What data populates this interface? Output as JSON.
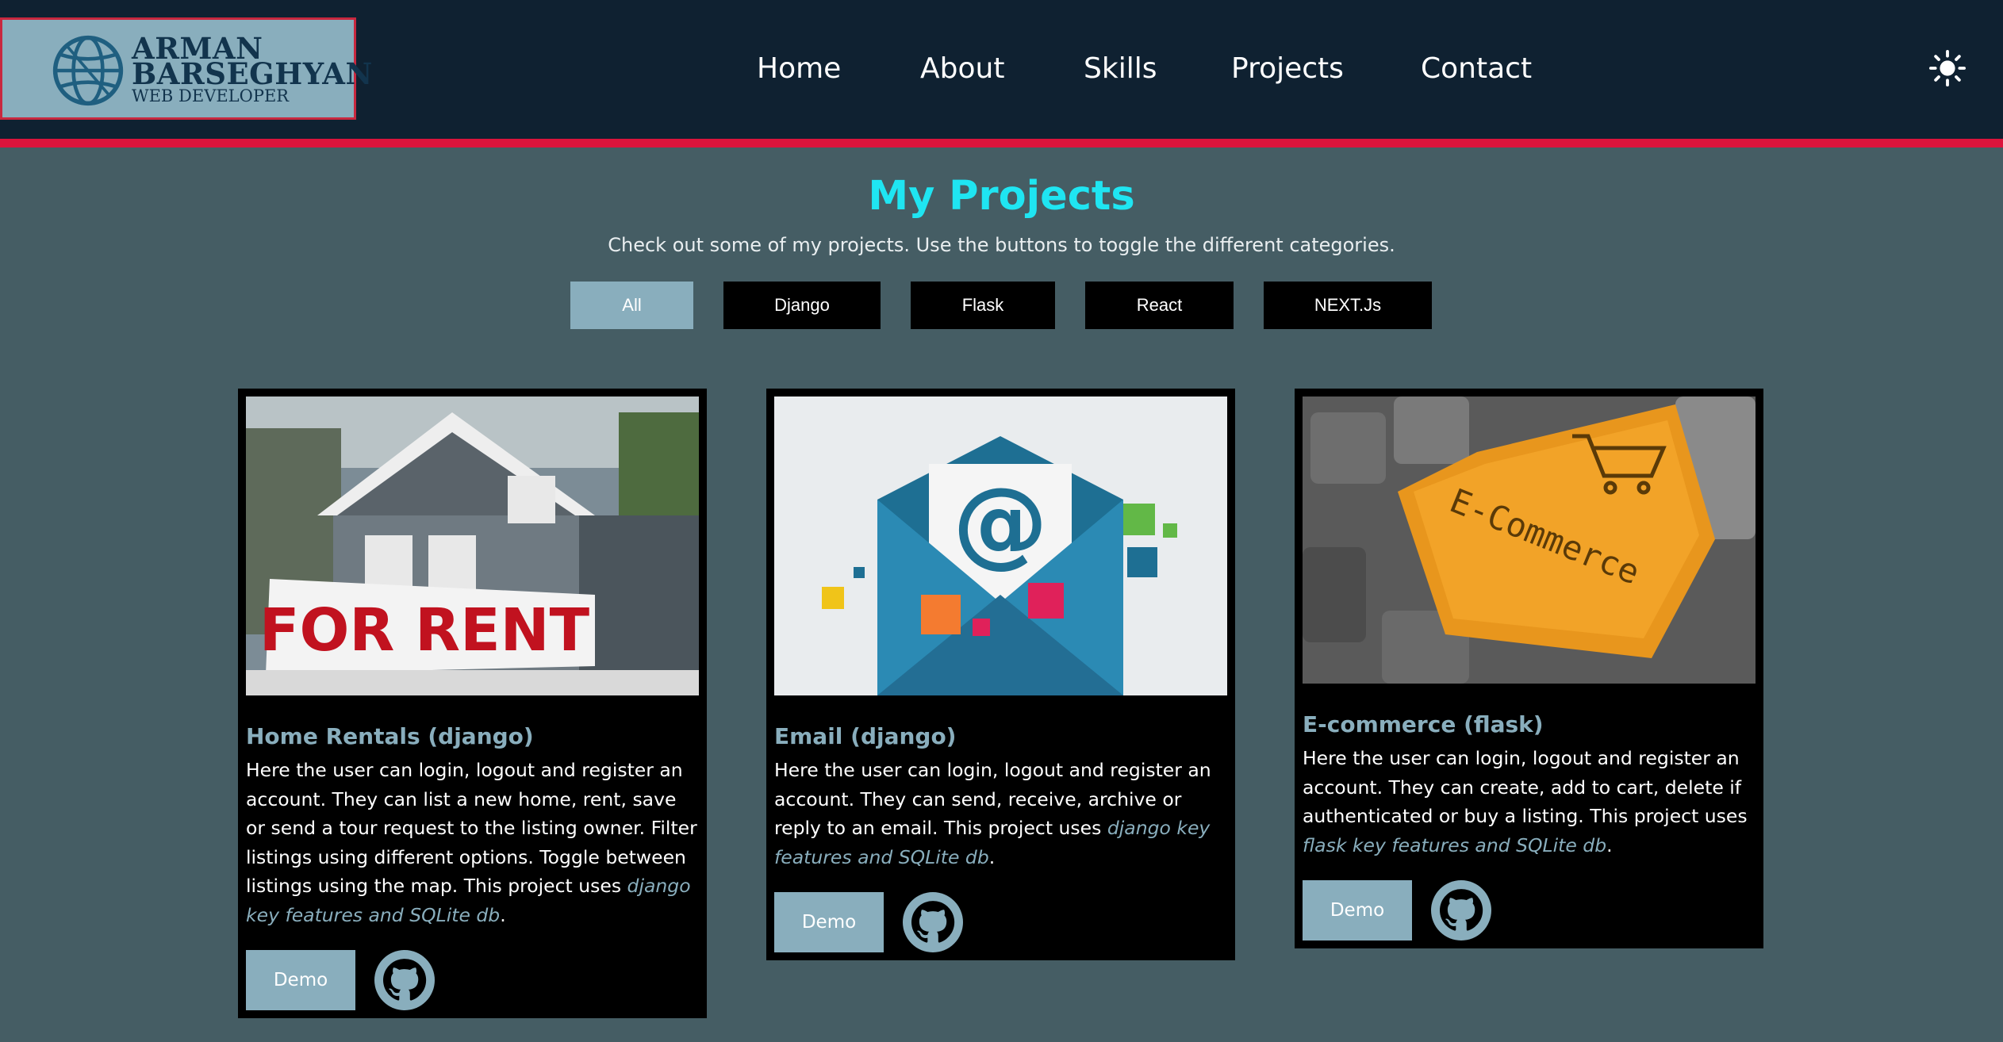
{
  "header": {
    "logo": {
      "name_line1": "ARMAN",
      "name_line2": "BARSEGHYAN",
      "role": "WEB DEVELOPER",
      "icon": "globe-icon"
    },
    "nav": [
      "Home",
      "About",
      "Skills",
      "Projects",
      "Contact"
    ],
    "theme_icon": "sun-icon"
  },
  "projects": {
    "title": "My Projects",
    "subtitle": "Check out some of my projects. Use the buttons to toggle the different categories.",
    "filters": [
      "All",
      "Django",
      "Flask",
      "React",
      "NEXT.Js"
    ],
    "active_filter": "All",
    "cards": [
      {
        "title": "Home Rentals (django)",
        "desc": "Here the user can login, logout and register an account. They can list a new home, rent, save or send a tour request to the listing owner. Filter listings using different options. Toggle between listings using the map. This project uses ",
        "desc_em": "django key features and SQLite db",
        "desc_end": ".",
        "image_text": "FOR RENT",
        "demo_label": "Demo",
        "icon": "github-icon"
      },
      {
        "title": "Email (django)",
        "desc": "Here the user can login, logout and register an account. They can send, receive, archive or reply to an email. This project uses ",
        "desc_em": "django key features and SQLite db",
        "desc_end": ".",
        "image_text": "@",
        "demo_label": "Demo",
        "icon": "github-icon"
      },
      {
        "title": "E-commerce (flask)",
        "desc": "Here the user can login, logout and register an account. They can create, add to cart, delete if authenticated or buy a listing. This project uses ",
        "desc_em": "flask key features and SQLite db",
        "desc_end": ".",
        "image_text": "E-Commerce",
        "demo_label": "Demo",
        "icon": "github-icon"
      }
    ]
  },
  "colors": {
    "page_bg": "#455d64",
    "header_bg": "#0f2131",
    "accent_red": "#dc143c",
    "accent_cyan": "#1fe5f2",
    "accent_blue": "#89aebd"
  }
}
